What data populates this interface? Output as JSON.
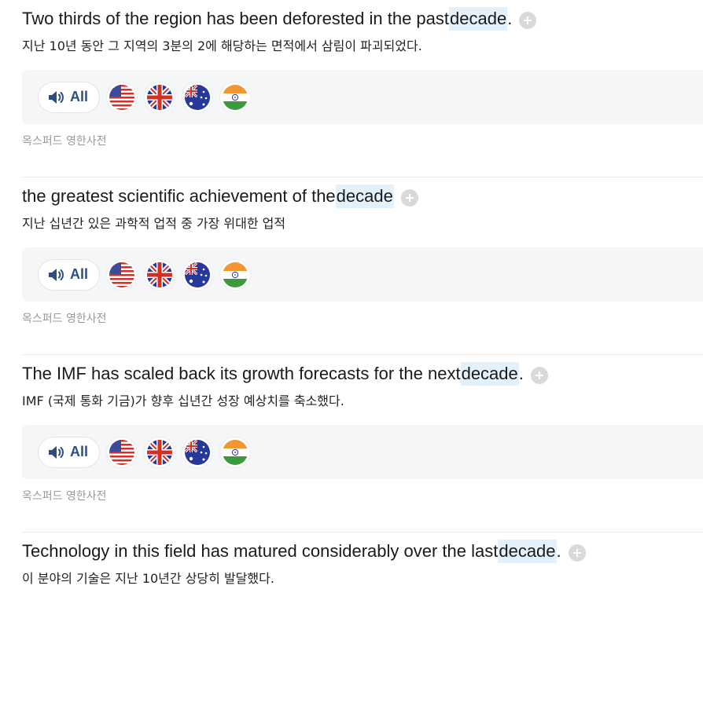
{
  "entries": [
    {
      "en_before": "Two thirds of the region has been deforested in the past ",
      "en_highlight": "decade",
      "en_after": ".",
      "ko": "지난 10년 동안 그 지역의 3분의 2에 해당하는 면적에서 삼림이 파괴되었다.",
      "all_label": "All",
      "source": "옥스퍼드 영한사전"
    },
    {
      "en_before": "the greatest scientific achievement of the ",
      "en_highlight": "decade",
      "en_after": "",
      "ko": "지난 십년간 있은 과학적 업적 중 가장 위대한 업적",
      "all_label": "All",
      "source": "옥스퍼드 영한사전"
    },
    {
      "en_before": "The IMF has scaled back its growth forecasts for the next ",
      "en_highlight": "decade",
      "en_after": ".",
      "ko": "IMF (국제 통화 기금)가 향후 십년간 성장 예상치를 축소했다.",
      "all_label": "All",
      "source": "옥스퍼드 영한사전"
    },
    {
      "en_before": "Technology in this field has matured considerably over the last ",
      "en_highlight": "decade",
      "en_after": ".",
      "ko": "이 분야의 기술은 지난 10년간 상당히 발달했다.",
      "all_label": "All",
      "source": ""
    }
  ],
  "flags": [
    "us-flag-icon",
    "uk-flag-icon",
    "au-flag-icon",
    "in-flag-icon"
  ],
  "colors": {
    "highlight": "#e3f1fc",
    "accent": "#2e4d82",
    "add_button": "#d9d9d9"
  }
}
